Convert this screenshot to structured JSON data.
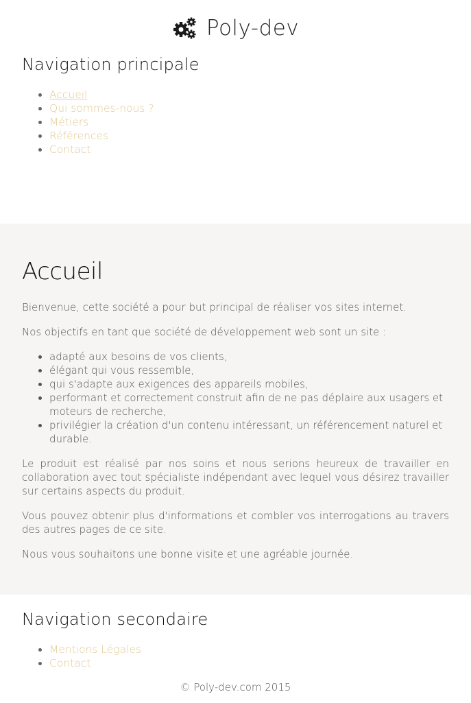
{
  "header": {
    "logo_icon": "gears-icon",
    "site_title": "Poly-dev"
  },
  "primary_nav": {
    "heading": "Navigation principale",
    "items": [
      {
        "label": "Accueil",
        "active": true
      },
      {
        "label": "Qui sommes-nous ?",
        "active": false
      },
      {
        "label": "Métiers",
        "active": false
      },
      {
        "label": "Références",
        "active": false
      },
      {
        "label": "Contact",
        "active": false
      }
    ]
  },
  "main": {
    "title": "Accueil",
    "intro": "Bienvenue, cette société a pour but principal de réaliser vos sites internet.",
    "goals_intro": "Nos objectifs en tant que société de développement web sont un site :",
    "goals": [
      "adapté aux besoins de vos clients,",
      "élégant qui vous ressemble,",
      "qui s'adapte aux exigences des appareils mobiles,",
      "performant et correctement construit afin de ne pas déplaire aux usagers et moteurs de recherche,",
      "privilégier la création d'un contenu intéressant, un référencement naturel et durable."
    ],
    "paragraph_collab": "Le produit est réalisé par nos soins et nous serions heureux de travailler en collaboration avec tout spécialiste indépendant avec lequel vous désirez travailler sur certains aspects du produit.",
    "paragraph_info": "Vous pouvez obtenir plus d'informations et combler vos interrogations au travers des autres pages de ce site.",
    "paragraph_closing": "Nous vous souhaitons une bonne visite et une agréable journée."
  },
  "secondary_nav": {
    "heading": "Navigation secondaire",
    "items": [
      {
        "label": "Mentions Légales"
      },
      {
        "label": "Contact"
      }
    ]
  },
  "footer": {
    "copyright": "© Poly-dev.com 2015"
  },
  "colors": {
    "link": "#e2c891",
    "text": "#555555",
    "heading": "#111111",
    "main_bg": "#f6f5f3"
  }
}
